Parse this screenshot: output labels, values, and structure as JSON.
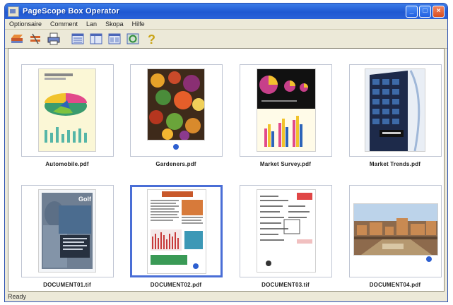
{
  "window": {
    "title": "PageScope Box Operator"
  },
  "menu": [
    "Optionsaire",
    "Comment",
    "Lan",
    "Skopa",
    "Hilfe"
  ],
  "toolbar": {
    "buttons": [
      {
        "icon": "pen-icon"
      },
      {
        "icon": "scissors-icon"
      },
      {
        "icon": "printer-icon"
      },
      {
        "icon": "list-view-icon"
      },
      {
        "icon": "detail-view-icon"
      },
      {
        "icon": "thumbnail-view-icon"
      },
      {
        "icon": "refresh-icon"
      },
      {
        "icon": "help-icon"
      }
    ]
  },
  "documents": [
    {
      "name": "Automobile.pdf",
      "preview": "pie-chart"
    },
    {
      "name": "Gardeners.pdf",
      "preview": "garden"
    },
    {
      "name": "Market Survey.pdf",
      "preview": "market"
    },
    {
      "name": "Market Trends.pdf",
      "preview": "building"
    },
    {
      "name": "DOCUMENT01.tif",
      "preview": "portrait"
    },
    {
      "name": "DOCUMENT02.pdf",
      "preview": "report",
      "selected": true
    },
    {
      "name": "DOCUMENT03.tif",
      "preview": "form"
    },
    {
      "name": "DOCUMENT04.pdf",
      "preview": "city"
    }
  ],
  "status": "Ready",
  "colors": {
    "selection": "#4a6ed6",
    "titlebar": "#1f58d2"
  }
}
